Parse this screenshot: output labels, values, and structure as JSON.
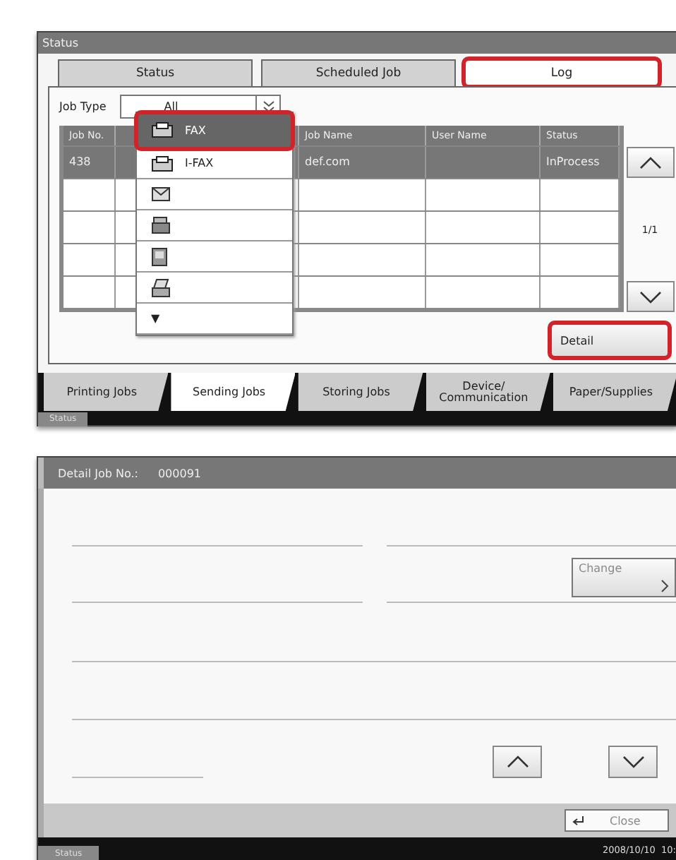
{
  "status_screen": {
    "title": "Status",
    "tabs": [
      {
        "label": "Status",
        "selected": false,
        "highlighted": false
      },
      {
        "label": "Scheduled Job",
        "selected": false,
        "highlighted": false
      },
      {
        "label": "Log",
        "selected": true,
        "highlighted": true
      }
    ],
    "job_type": {
      "label": "Job Type",
      "value": "All"
    },
    "job_type_menu": [
      {
        "kind": "text",
        "label": "FAX",
        "selected": true,
        "highlighted": true
      },
      {
        "kind": "text",
        "label": "I-FAX",
        "selected": false,
        "highlighted": false
      },
      {
        "kind": "icon",
        "selected": false,
        "highlighted": false
      },
      {
        "kind": "icon",
        "selected": false,
        "highlighted": false
      },
      {
        "kind": "icon",
        "selected": false,
        "highlighted": false
      },
      {
        "kind": "icon",
        "selected": false,
        "highlighted": false
      },
      {
        "kind": "more",
        "label": "▼",
        "selected": false,
        "highlighted": false
      }
    ],
    "table": {
      "columns": [
        "Job No.",
        "Job Name",
        "User Name",
        "Status"
      ],
      "rows": [
        {
          "job_no": "438",
          "job_name": "def.com",
          "status": "InProcess",
          "selected": true
        }
      ]
    },
    "page": "1/1",
    "detail_button": {
      "label": "Detail",
      "highlighted": true
    },
    "bottom_tabs": [
      {
        "label": "Printing Jobs",
        "selected": false
      },
      {
        "label": "Sending Jobs",
        "selected": true
      },
      {
        "label": "Storing Jobs",
        "selected": false
      },
      {
        "label": "Device/ Communication",
        "selected": false
      },
      {
        "label": "Paper/Supplies",
        "selected": false
      }
    ],
    "status_bar": {
      "label": "Status"
    }
  },
  "detail_screen": {
    "title": "Detail Job No.:",
    "job_no": "000091",
    "change_button": "Change",
    "close_button": "Close",
    "status_bar": {
      "label": "Status",
      "datetime": "2008/10/10  10:"
    }
  }
}
